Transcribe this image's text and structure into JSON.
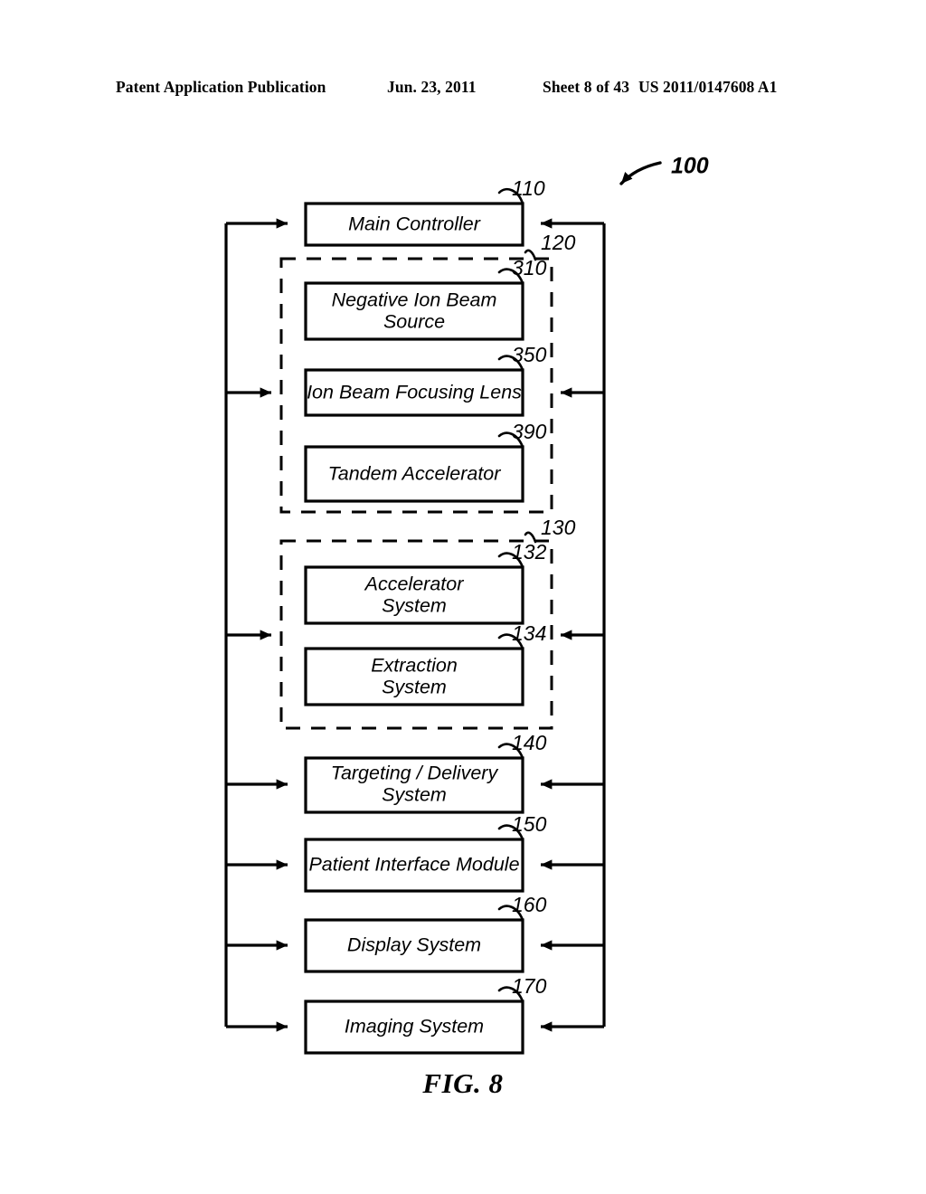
{
  "header": {
    "publication": "Patent Application Publication",
    "date": "Jun. 23, 2011",
    "sheet": "Sheet 8 of 43",
    "patent_number": "US 2011/0147608 A1"
  },
  "figure": {
    "caption": "FIG. 8",
    "system_ref": "100"
  },
  "diagram": {
    "type": "block-diagram",
    "blocks": [
      {
        "id": "main-controller",
        "label": "Main Controller",
        "ref": "110",
        "lines": [
          "Main Controller"
        ]
      },
      {
        "id": "negative-ion-beam-source",
        "label": "Negative Ion Beam Source",
        "ref": "310",
        "lines": [
          "Negative Ion Beam",
          "Source"
        ]
      },
      {
        "id": "ion-beam-focusing-lens",
        "label": "Ion Beam Focusing Lens",
        "ref": "350",
        "lines": [
          "Ion Beam Focusing Lens"
        ]
      },
      {
        "id": "tandem-accelerator",
        "label": "Tandem Accelerator",
        "ref": "390",
        "lines": [
          "Tandem Accelerator"
        ]
      },
      {
        "id": "accelerator-system",
        "label": "Accelerator System",
        "ref": "132",
        "lines": [
          "Accelerator",
          "System"
        ]
      },
      {
        "id": "extraction-system",
        "label": "Extraction System",
        "ref": "134",
        "lines": [
          "Extraction",
          "System"
        ]
      },
      {
        "id": "targeting-delivery-system",
        "label": "Targeting / Delivery System",
        "ref": "140",
        "lines": [
          "Targeting / Delivery",
          "System"
        ]
      },
      {
        "id": "patient-interface-module",
        "label": "Patient Interface Module",
        "ref": "150",
        "lines": [
          "Patient Interface Module"
        ]
      },
      {
        "id": "display-system",
        "label": "Display System",
        "ref": "160",
        "lines": [
          "Display System"
        ]
      },
      {
        "id": "imaging-system",
        "label": "Imaging System",
        "ref": "170",
        "lines": [
          "Imaging System"
        ]
      }
    ],
    "groups": [
      {
        "id": "injection-system",
        "ref": "120",
        "contains": [
          "negative-ion-beam-source",
          "ion-beam-focusing-lens",
          "tandem-accelerator"
        ]
      },
      {
        "id": "synchrotron",
        "ref": "130",
        "contains": [
          "accelerator-system",
          "extraction-system"
        ]
      }
    ]
  },
  "labels": {
    "main_controller": "Main Controller",
    "negative_ion_beam_source_l1": "Negative Ion Beam",
    "negative_ion_beam_source_l2": "Source",
    "ion_beam_focusing_lens": "Ion Beam Focusing Lens",
    "tandem_accelerator": "Tandem Accelerator",
    "accelerator_system_l1": "Accelerator",
    "accelerator_system_l2": "System",
    "extraction_system_l1": "Extraction",
    "extraction_system_l2": "System",
    "targeting_delivery_l1": "Targeting / Delivery",
    "targeting_delivery_l2": "System",
    "patient_interface_module": "Patient Interface Module",
    "display_system": "Display System",
    "imaging_system": "Imaging System"
  },
  "refs": {
    "r100": "100",
    "r110": "110",
    "r120": "120",
    "r130": "130",
    "r132": "132",
    "r134": "134",
    "r140": "140",
    "r150": "150",
    "r160": "160",
    "r170": "170",
    "r310": "310",
    "r350": "350",
    "r390": "390"
  },
  "colors": {
    "ink": "#000000",
    "paper": "#ffffff"
  }
}
